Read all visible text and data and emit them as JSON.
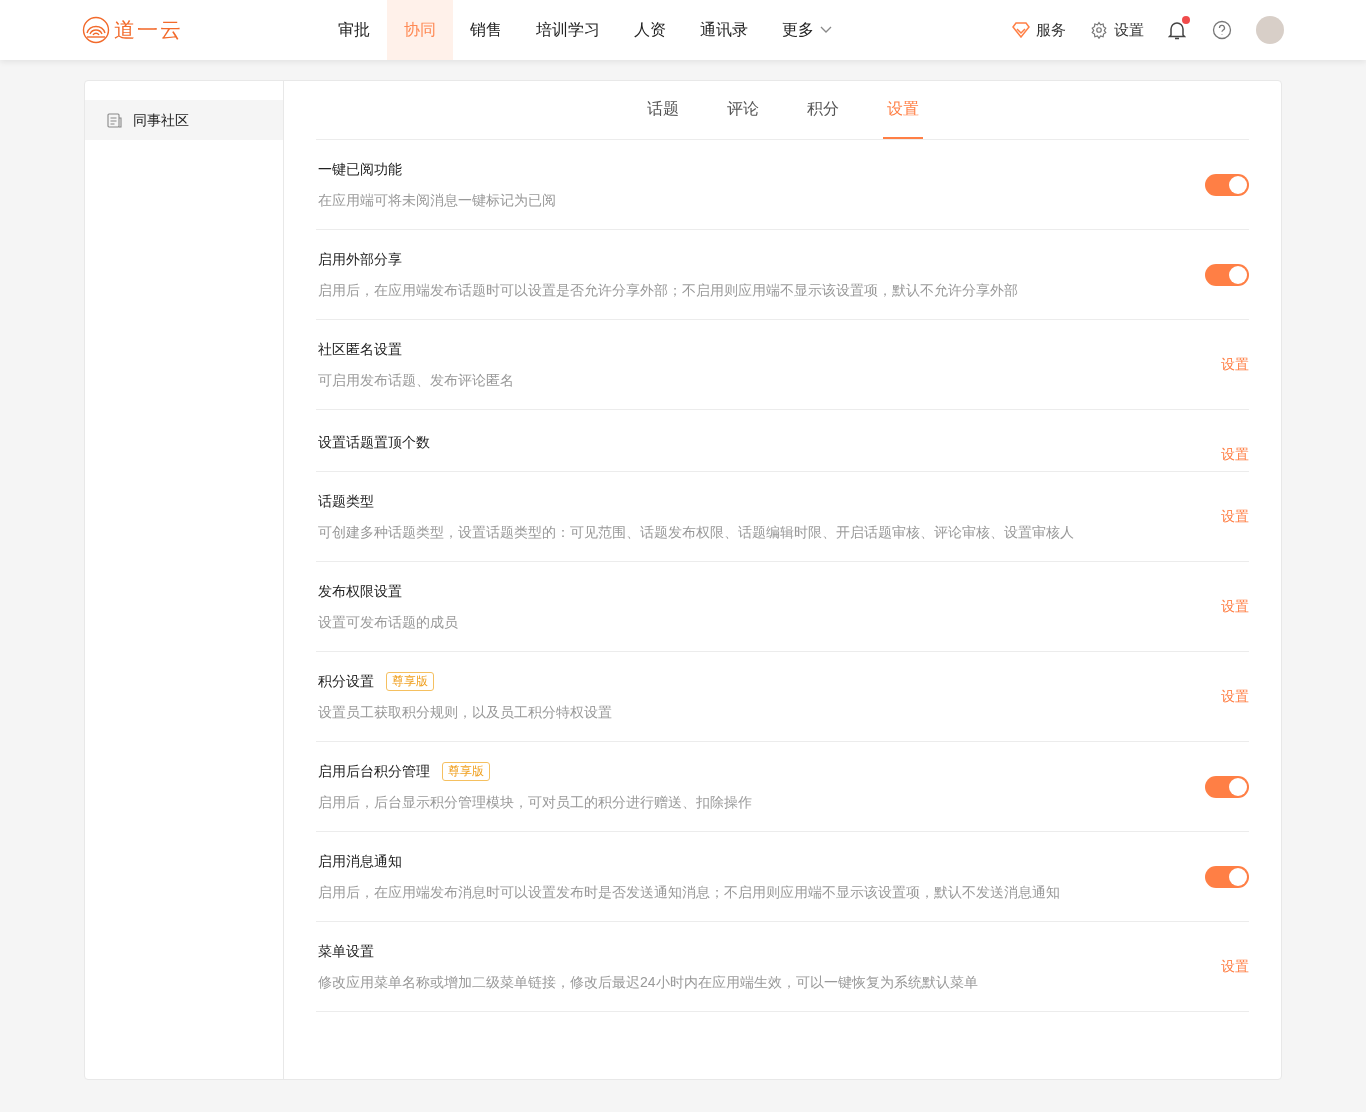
{
  "logo": {
    "text": "道一云"
  },
  "nav": [
    {
      "label": "审批",
      "selected": false
    },
    {
      "label": "协同",
      "selected": true
    },
    {
      "label": "销售",
      "selected": false
    },
    {
      "label": "培训学习",
      "selected": false
    },
    {
      "label": "人资",
      "selected": false
    },
    {
      "label": "通讯录",
      "selected": false
    },
    {
      "label": "更多",
      "selected": false,
      "dropdown": true
    }
  ],
  "header_actions": {
    "service": "服务",
    "settings": "设置",
    "notification_dot": true
  },
  "sidebar": {
    "items": [
      {
        "label": "同事社区",
        "selected": true
      }
    ]
  },
  "tabs": [
    {
      "label": "话题",
      "selected": false
    },
    {
      "label": "评论",
      "selected": false
    },
    {
      "label": "积分",
      "selected": false
    },
    {
      "label": "设置",
      "selected": true
    }
  ],
  "settings": [
    {
      "kind": "toggle",
      "title": "一键已阅功能",
      "description": "在应用端可将未阅消息一键标记为已阅",
      "on": true
    },
    {
      "kind": "toggle",
      "title": "启用外部分享",
      "description": "启用后，在应用端发布话题时可以设置是否允许分享外部；不启用则应用端不显示该设置项，默认不允许分享外部",
      "on": true
    },
    {
      "kind": "link",
      "title": "社区匿名设置",
      "description": "可启用发布话题、发布评论匿名",
      "action": "设置"
    },
    {
      "kind": "link",
      "title": "设置话题置顶个数",
      "action": "设置"
    },
    {
      "kind": "link",
      "title": "话题类型",
      "description": "可创建多种话题类型，设置话题类型的：可见范围、话题发布权限、话题编辑时限、开启话题审核、评论审核、设置审核人",
      "action": "设置"
    },
    {
      "kind": "link",
      "title": "发布权限设置",
      "description": "设置可发布话题的成员",
      "action": "设置"
    },
    {
      "kind": "link",
      "title": "积分设置",
      "badge": "尊享版",
      "description": "设置员工获取积分规则，以及员工积分特权设置",
      "action": "设置"
    },
    {
      "kind": "toggle",
      "title": "启用后台积分管理",
      "badge": "尊享版",
      "description": "启用后，后台显示积分管理模块，可对员工的积分进行赠送、扣除操作",
      "on": true
    },
    {
      "kind": "toggle",
      "title": "启用消息通知",
      "description": "启用后，在应用端发布消息时可以设置发布时是否发送通知消息；不启用则应用端不显示该设置项，默认不发送消息通知",
      "on": true
    },
    {
      "kind": "link",
      "title": "菜单设置",
      "description": "修改应用菜单名称或增加二级菜单链接，修改后最迟24小时内在应用端生效，可以一键恢复为系统默认菜单",
      "action": "设置"
    }
  ]
}
